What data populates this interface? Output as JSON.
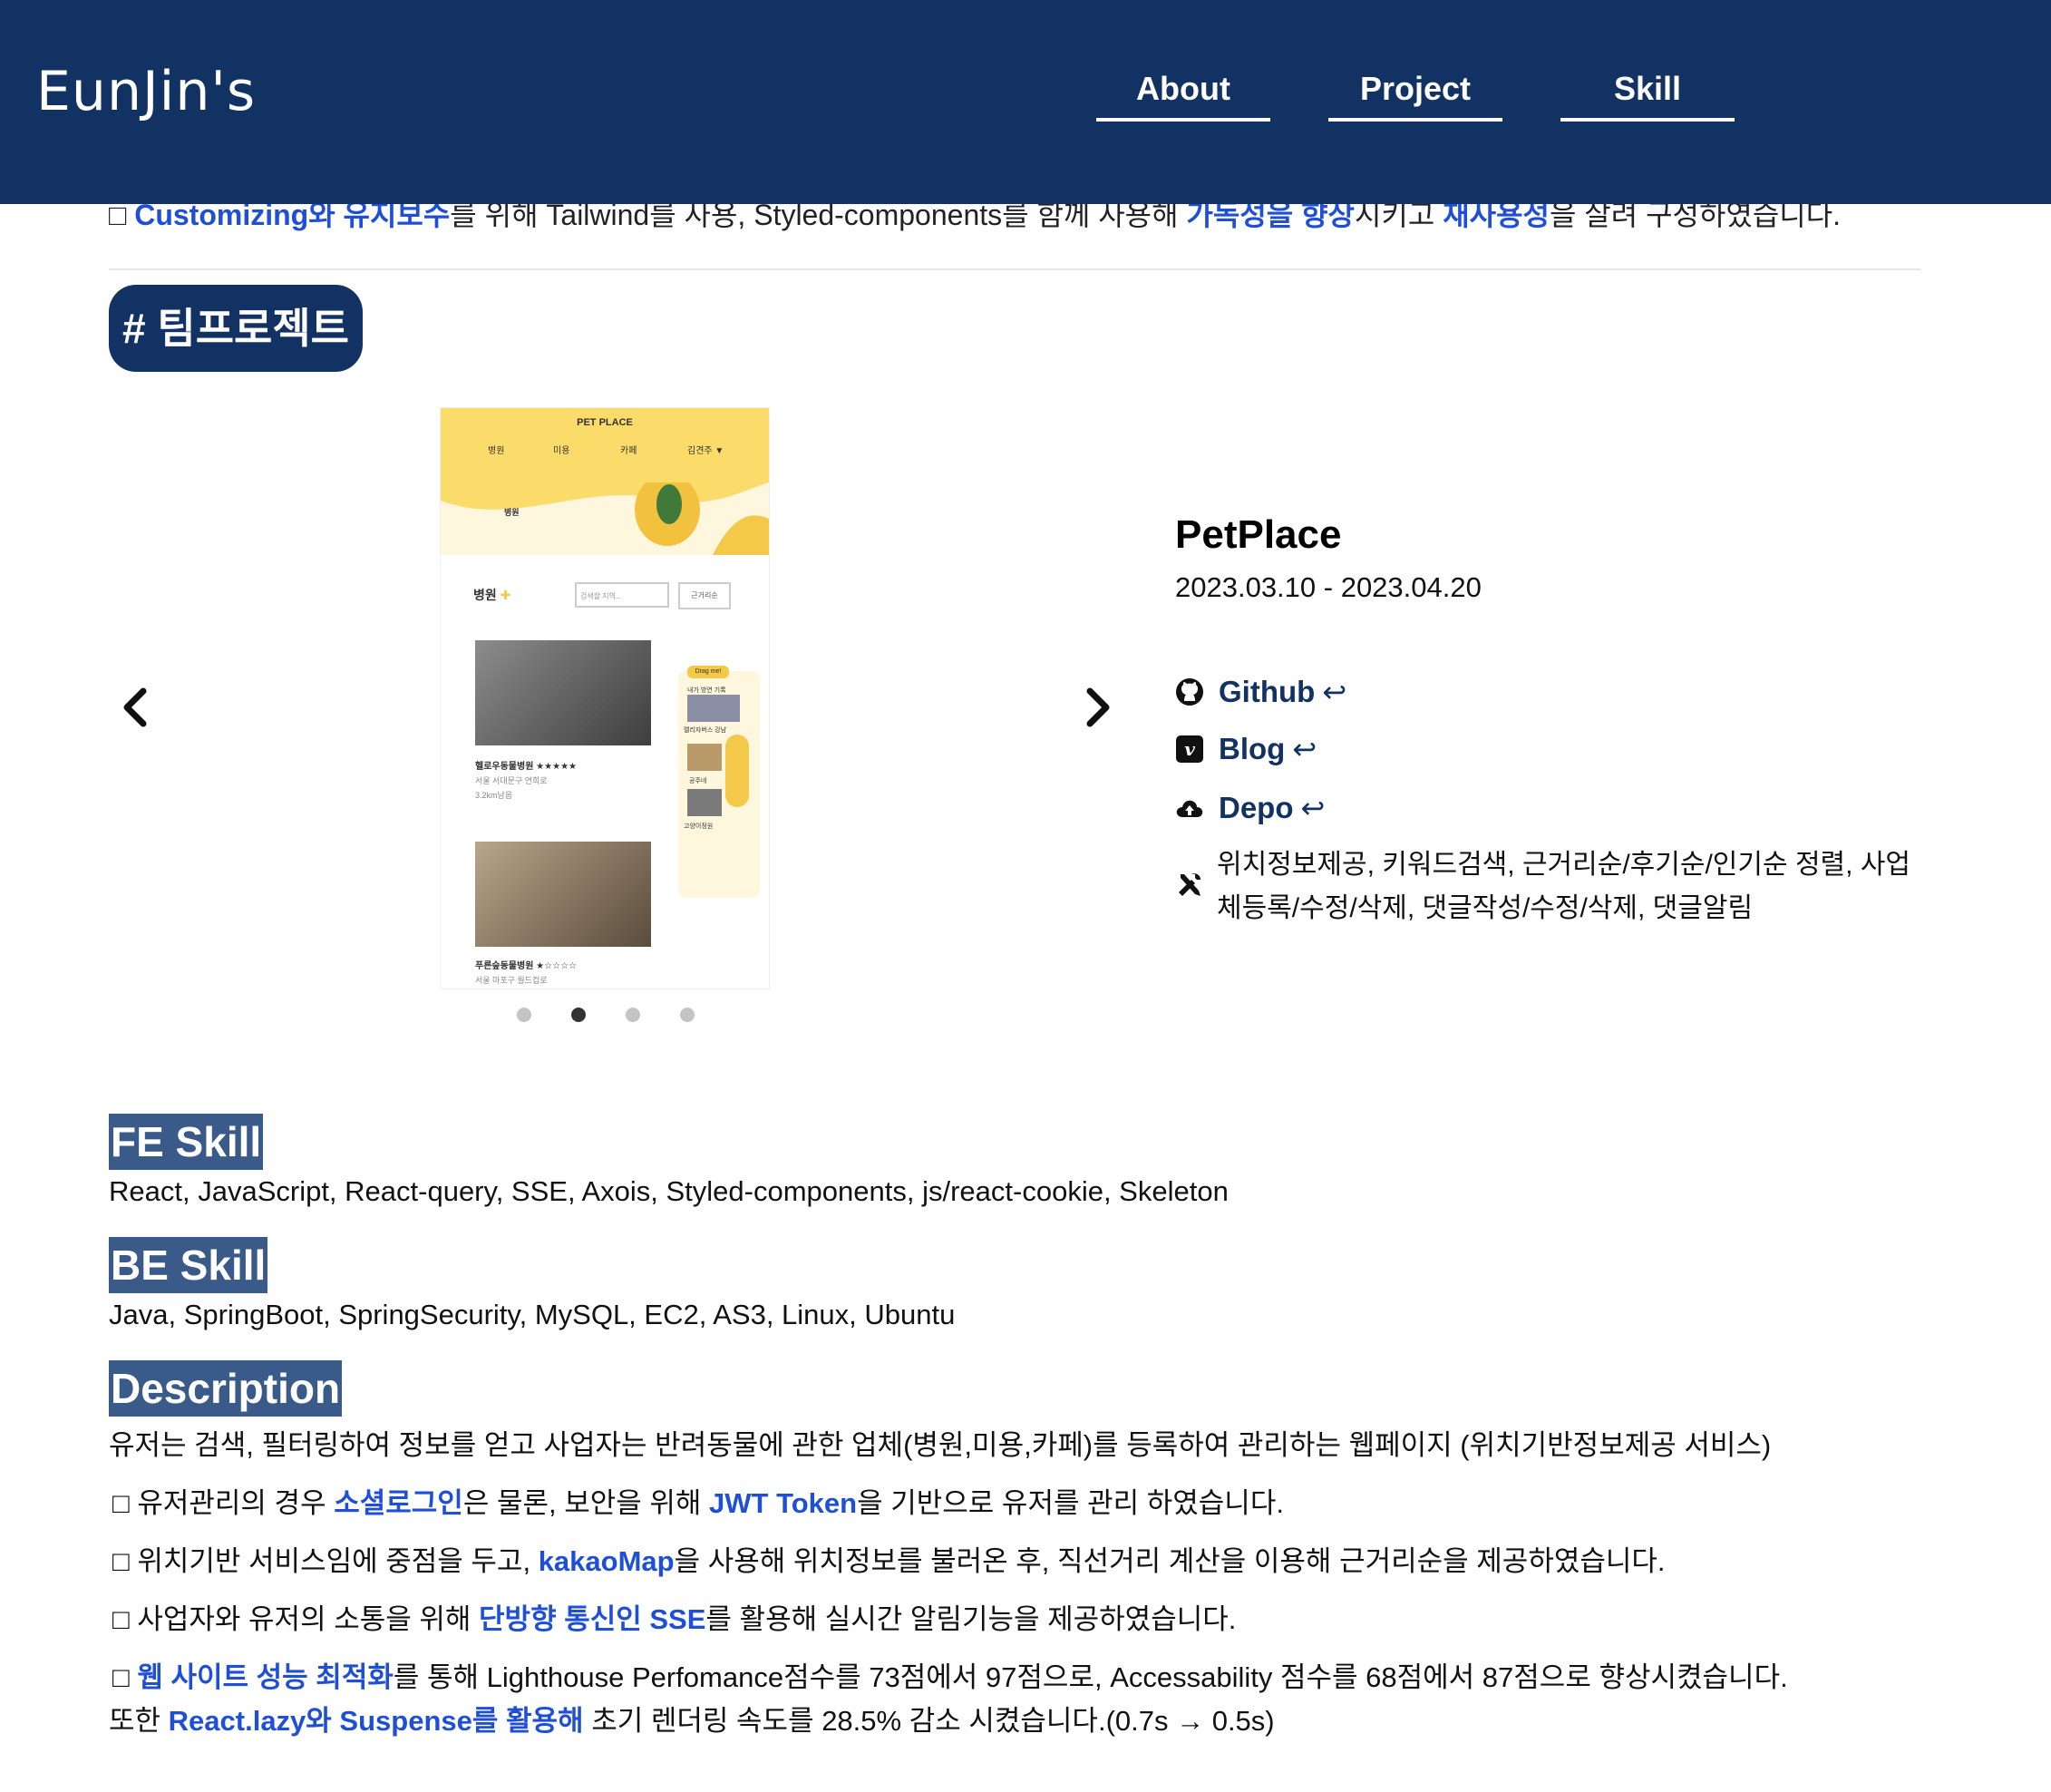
{
  "header": {
    "logo": "EunJin's",
    "nav": [
      "About",
      "Project",
      "Skill"
    ]
  },
  "prev_section": {
    "line_parts": [
      "□ ",
      "Customizing와 유지보수",
      "를 위해 Tailwind를 사용, Styled-components를 함께 사용해 ",
      "가독성을 향상",
      "시키고 ",
      "재사용성",
      "을 살려 구성하였습니다."
    ]
  },
  "team_badge": "# 팀프로젝트",
  "carousel": {
    "active_index": 1,
    "slide_count": 4,
    "screenshot": {
      "brand": "PET PLACE",
      "menu": [
        "병원",
        "미용",
        "카페",
        "김견주 ▼"
      ],
      "hero_title": "병원",
      "section_title": "병원",
      "search_placeholder": "검색할 지역..",
      "sort_button": "근거리순",
      "items": [
        {
          "name": "헬로우동물병원 ★★★★★",
          "address": "서울 서대문구 연희로",
          "distance": "3.2km남음"
        },
        {
          "name": "푸른숲동물병원 ★☆☆☆☆",
          "address": "서울 마포구 월드컵로",
          "distance": ""
        }
      ],
      "side_label": "Drag me!",
      "side_items": [
        "내가 방연 기록",
        "멜리자버스 강남",
        "공주네",
        "고양이정원"
      ]
    }
  },
  "project": {
    "name": "PetPlace",
    "date": "2023.03.10 - 2023.04.20",
    "links": [
      {
        "icon": "github-icon",
        "label": "Github"
      },
      {
        "icon": "velog-icon",
        "label": "Blog"
      },
      {
        "icon": "cloud-upload-icon",
        "label": "Depo"
      }
    ],
    "return_glyph": "↩",
    "features": "위치정보제공, 키워드검색, 근거리순/후기순/인기순 정렬, 사업체등록/수정/삭제, 댓글작성/수정/삭제, 댓글알림"
  },
  "skills": {
    "fe_title": "FE Skill",
    "fe_text": "React, JavaScript, React-query, SSE, Axois, Styled-components, js/react-cookie, Skeleton",
    "be_title": "BE Skill",
    "be_text": "Java, SpringBoot, SpringSecurity, MySQL, EC2, AS3, Linux, Ubuntu",
    "desc_title": "Description",
    "desc_text": "유저는 검색, 필터링하여 정보를 얻고 사업자는 반려동물에 관한 업체(병원,미용,카페)를 등록하여 관리하는 웹페이지 (위치기반정보제공 서비스)"
  },
  "bullets": [
    {
      "p1": "□ 유저관리의 경우 ",
      "h1": "소셜로그인",
      "p2": "은 물론, 보안을 위해 ",
      "h2": "JWT Token",
      "p3": "을 기반으로 유저를 관리 하였습니다."
    },
    {
      "p1": "□ 위치기반 서비스임에 중점을 두고, ",
      "h1": "kakaoMap",
      "p2": "을 사용해 위치정보를 불러온 후, 직선거리 계산을 이용해 근거리순을 제공하였습니다.",
      "h2": "",
      "p3": ""
    },
    {
      "p1": "□ 사업자와 유저의 소통을 위해 ",
      "h1": "단방향 통신인 SSE",
      "p2": "를 활용해 실시간 알림기능을 제공하였습니다.",
      "h2": "",
      "p3": ""
    },
    {
      "p1": "□ ",
      "h1": "웹 사이트 성능 최적화",
      "p2": "를 통해 Lighthouse Perfomance점수를 73점에서 97점으로, Accessability 점수를 68점에서 87점으로 향상시켰습니다.",
      "h2": "",
      "p3": ""
    }
  ],
  "last_line": {
    "p1": "또한 ",
    "h1": "React.lazy와 Suspense를 활용해",
    "p2": " 초기 렌더링 속도를 28.5% 감소 시켰습니다.(0.7s → 0.5s)"
  },
  "colors": {
    "header": "#133264",
    "highlight": "#1f4fd6",
    "section_tag": "#3a5a8a"
  }
}
